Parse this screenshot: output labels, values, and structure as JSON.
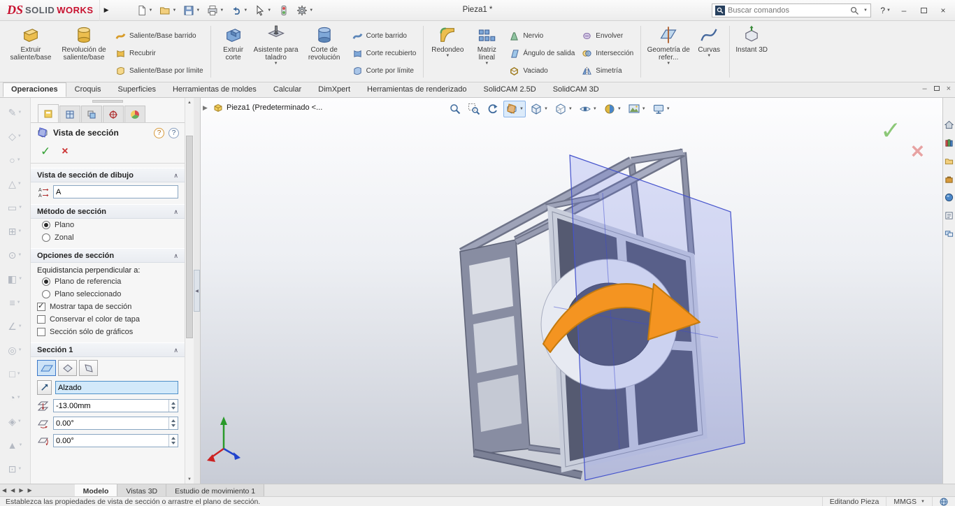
{
  "titlebar": {
    "brand_ds": "DS",
    "brand_solid": "SOLID",
    "brand_works": "WORKS",
    "title": "Pieza1 *",
    "search_placeholder": "Buscar comandos",
    "help": "?"
  },
  "ribbon": {
    "g1b1": "Extruir saliente/base",
    "g1b2": "Revolución de saliente/base",
    "g1s1": "Saliente/Base barrido",
    "g1s2": "Recubrir",
    "g1s3": "Saliente/Base por límite",
    "g2b1": "Extruir corte",
    "g2b2": "Asistente para taladro",
    "g2b3": "Corte de revolución",
    "g2s1": "Corte barrido",
    "g2s2": "Corte recubierto",
    "g2s3": "Corte por límite",
    "g3b1": "Redondeo",
    "g3b2": "Matriz lineal",
    "g3s1": "Nervio",
    "g3s2": "Ángulo de salida",
    "g3s3": "Vaciado",
    "g4s1": "Envolver",
    "g4s2": "Intersección",
    "g4s3": "Simetría",
    "g5b1": "Geometría de refer...",
    "g5b2": "Curvas",
    "g6b1": "Instant 3D"
  },
  "tabs": {
    "t0": "Operaciones",
    "t1": "Croquis",
    "t2": "Superficies",
    "t3": "Herramientas de moldes",
    "t4": "Calcular",
    "t5": "DimXpert",
    "t6": "Herramientas de renderizado",
    "t7": "SolidCAM 2.5D",
    "t8": "SolidCAM 3D",
    "active": "Operaciones"
  },
  "panel": {
    "title": "Vista de sección",
    "sec1_header": "Vista de sección de dibujo",
    "name_value": "A",
    "sec2_header": "Método de sección",
    "radio_plano": "Plano",
    "radio_zonal": "Zonal",
    "sec3_header": "Opciones de sección",
    "offset_label": "Equidistancia perpendicular a:",
    "radio_ref": "Plano de referencia",
    "radio_sel": "Plano seleccionado",
    "chk1": "Mostrar tapa de sección",
    "chk2": "Conservar el color de tapa",
    "chk3": "Sección sólo de gráficos",
    "sec4_header": "Sección 1",
    "plane_value": "Alzado",
    "offset_value": "-13.00mm",
    "angle1_value": "0.00°",
    "angle2_value": "0.00°",
    "state": {
      "method_selected": "Plano",
      "offset_selected": "Plano de referencia",
      "mostrar_tapa": true,
      "conservar_color": false,
      "solo_graficos": false
    }
  },
  "viewport": {
    "tree_node": "Pieza1  (Predeterminado <...",
    "section_tool_active": true
  },
  "bottom": {
    "t0": "Modelo",
    "t1": "Vistas 3D",
    "t2": "Estudio de movimiento 1",
    "active": "Modelo"
  },
  "statusbar": {
    "message": "Establezca las propiedades de vista de sección o arrastre el plano de sección.",
    "editing": "Editando Pieza",
    "units": "MMGS"
  },
  "colors": {
    "brand_red": "#c8102e",
    "section_plane_blue": "#4553cc",
    "arrow_orange": "#f49421",
    "accept_green": "#33a033",
    "cancel_red": "#cc3333",
    "selection_blue": "#d2e9fa"
  },
  "icons": {
    "dropdown": "▼",
    "chevron_up": "∧",
    "accept": "✓",
    "cancel": "×",
    "flyout": "▶",
    "collapse": "◀",
    "nav_first": "◀",
    "nav_prev": "◀",
    "nav_next": "▶",
    "nav_last": "▶",
    "scroll_up": "▲",
    "scroll_down": "▼",
    "minimize": "–",
    "close": "×",
    "help": "?",
    "lt0": "✎",
    "lt1": "◇",
    "lt2": "○",
    "lt3": "△",
    "lt4": "▭",
    "lt5": "⊞",
    "lt6": "⊙",
    "lt7": "◧",
    "lt8": "≡",
    "lt9": "∠",
    "lt10": "◎",
    "lt11": "□",
    "lt12": "◔",
    "lt13": "◈",
    "lt14": "▲",
    "lt15": "⊡"
  }
}
